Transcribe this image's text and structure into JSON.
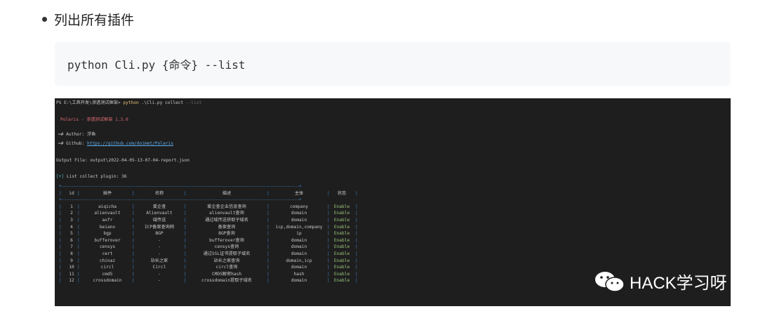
{
  "heading": "列出所有插件",
  "code_command": "python Cli.py {命令} --list",
  "terminal": {
    "prompt": "PS E:\\工具开发\\渗透测试框架>",
    "cmd_python": "python",
    "cmd_script": ".\\Cli.py collect",
    "cmd_flag": "--list",
    "banner": "Polaris - 渗透测试框架 1.3.0",
    "author_line": "=# Author: 浮鱼",
    "github_label": "=# Github:",
    "github_url": "https://github.com/doimet/Polaris",
    "output_file": "Output File: output\\2022-04-05-13-07-04-report.json",
    "list_marker": "[+]",
    "list_text": "List collect plugin: 36",
    "header": [
      "id",
      "插件",
      "名称",
      "描述",
      "主体",
      "状态"
    ],
    "rows": [
      [
        "1",
        "aiqicha",
        "爱企查",
        "爱企查企业信息查询",
        "company",
        "Enable"
      ],
      [
        "2",
        "alienvault",
        "Alienvault",
        "alienvault查询",
        "domain",
        "Enable"
      ],
      [
        "3",
        "axfr",
        "域传送",
        "通过域传送获取子域名",
        "domain",
        "Enable"
      ],
      [
        "4",
        "beianx",
        "ICP备案查询网",
        "备案查询",
        "icp,domain,company",
        "Enable"
      ],
      [
        "5",
        "bgp",
        "BGP",
        "BGP查询",
        "ip",
        "Enable"
      ],
      [
        "6",
        "bufferover",
        "-",
        "bufferover查询",
        "domain",
        "Enable"
      ],
      [
        "7",
        "censys",
        "-",
        "censys查询",
        "domain",
        "Enable"
      ],
      [
        "8",
        "cert",
        "-",
        "通过SSL证书提取子域名",
        "domain",
        "Enable"
      ],
      [
        "9",
        "chinaz",
        "站长之家",
        "站长之家查询",
        "domain,icp",
        "Enable"
      ],
      [
        "10",
        "circl",
        "Circl",
        "circl查询",
        "domain",
        "Enable"
      ],
      [
        "11",
        "cmd5",
        "-",
        "CMD5解密hash",
        "hash",
        "Enable"
      ],
      [
        "12",
        "crossdomain",
        "-",
        "crossdomain提取子域名",
        "domain",
        "Enable"
      ]
    ]
  },
  "watermark": "HACK学习呀",
  "colors": {
    "terminal_bg": "#1e1e1e",
    "code_bg": "#f6f8fa",
    "enable_green": "#98c379",
    "banner_red": "#e06c75"
  }
}
